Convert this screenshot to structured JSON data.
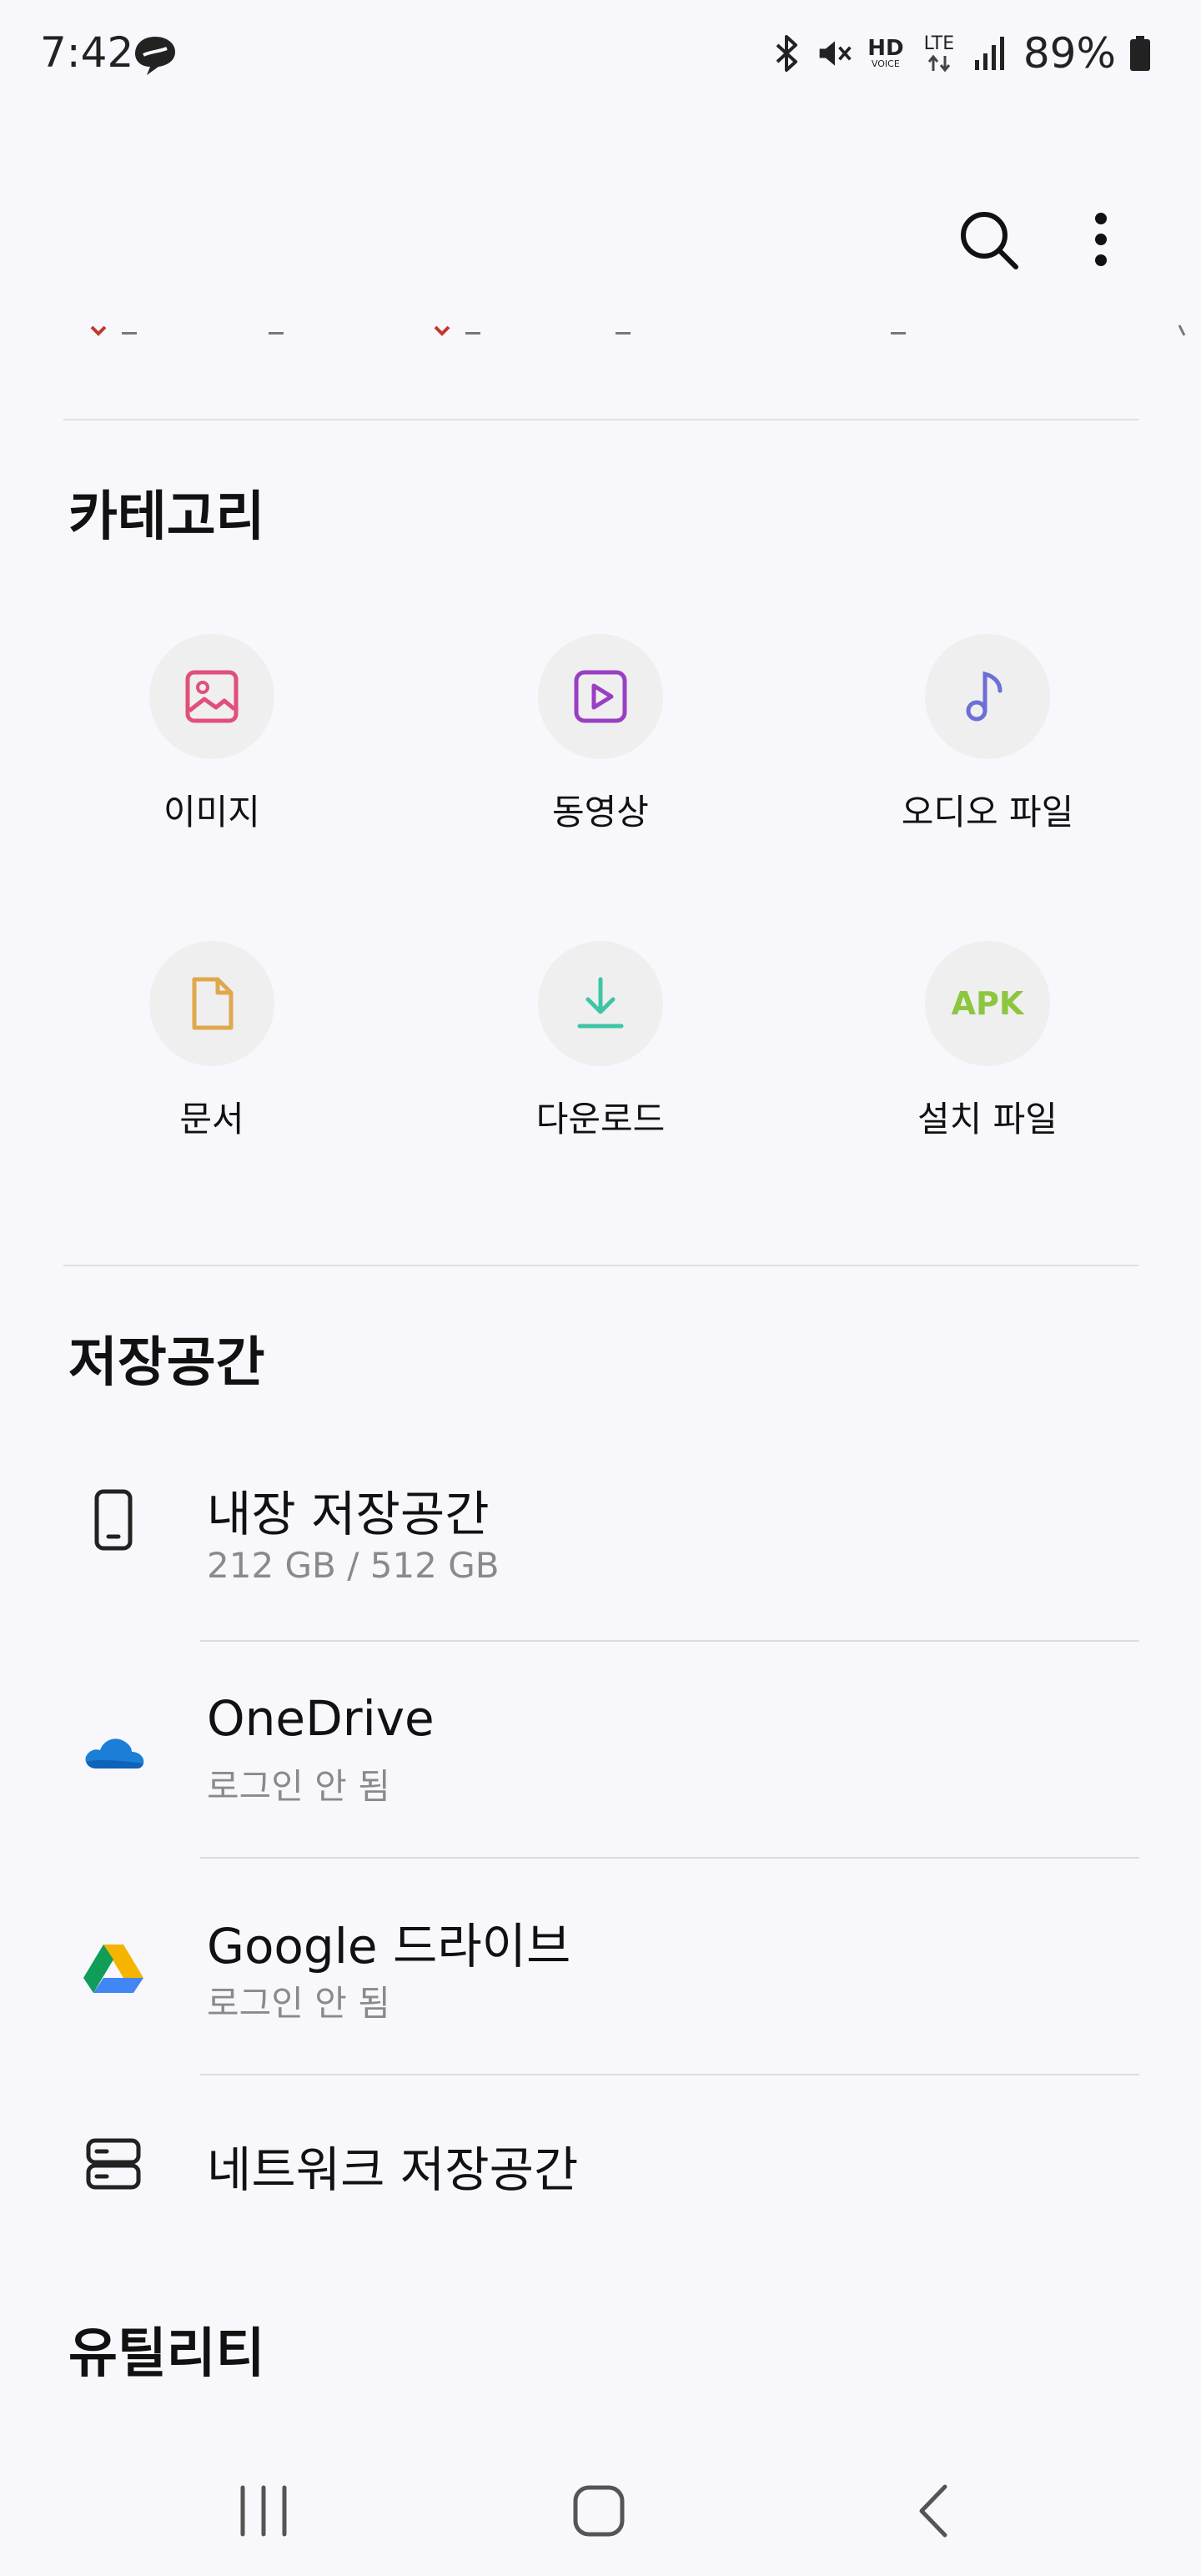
{
  "status_bar": {
    "time": "7:42",
    "battery_percent": "89%",
    "icons": [
      "app-notification-icon",
      "bluetooth-icon",
      "mute-icon",
      "hd-voice-icon",
      "lte-icon",
      "signal-icon",
      "battery-icon"
    ],
    "hd_voice_top": "HD",
    "hd_voice_bottom": "VOICE",
    "lte_label": "LTE"
  },
  "appbar": {
    "icons": [
      "search-icon",
      "more-options-icon"
    ]
  },
  "categories": {
    "title": "카테고리",
    "items": [
      {
        "label": "이미지",
        "icon": "image-icon",
        "color": "#e0507a"
      },
      {
        "label": "동영상",
        "icon": "video-icon",
        "color": "#9a3fc4"
      },
      {
        "label": "오디오 파일",
        "icon": "audio-icon",
        "color": "#6b6fd6"
      },
      {
        "label": "문서",
        "icon": "document-icon",
        "color": "#e0a84e"
      },
      {
        "label": "다운로드",
        "icon": "download-icon",
        "color": "#3fc4a6"
      },
      {
        "label": "설치 파일",
        "icon": "apk-icon",
        "color": "#8cc63f",
        "icon_text": "APK"
      }
    ]
  },
  "storage": {
    "title": "저장공간",
    "items": [
      {
        "title": "내장 저장공간",
        "subtitle": "212 GB / 512 GB",
        "icon": "phone-icon"
      },
      {
        "title": "OneDrive",
        "subtitle": "로그인 안 됨",
        "icon": "onedrive-icon"
      },
      {
        "title": "Google 드라이브",
        "subtitle": "로그인 안 됨",
        "icon": "google-drive-icon"
      },
      {
        "title": "네트워크 저장공간",
        "icon": "network-storage-icon"
      }
    ]
  },
  "utilities": {
    "title": "유틸리티"
  },
  "nav_bar": {
    "icons": [
      "recents-icon",
      "home-icon",
      "back-icon"
    ]
  }
}
